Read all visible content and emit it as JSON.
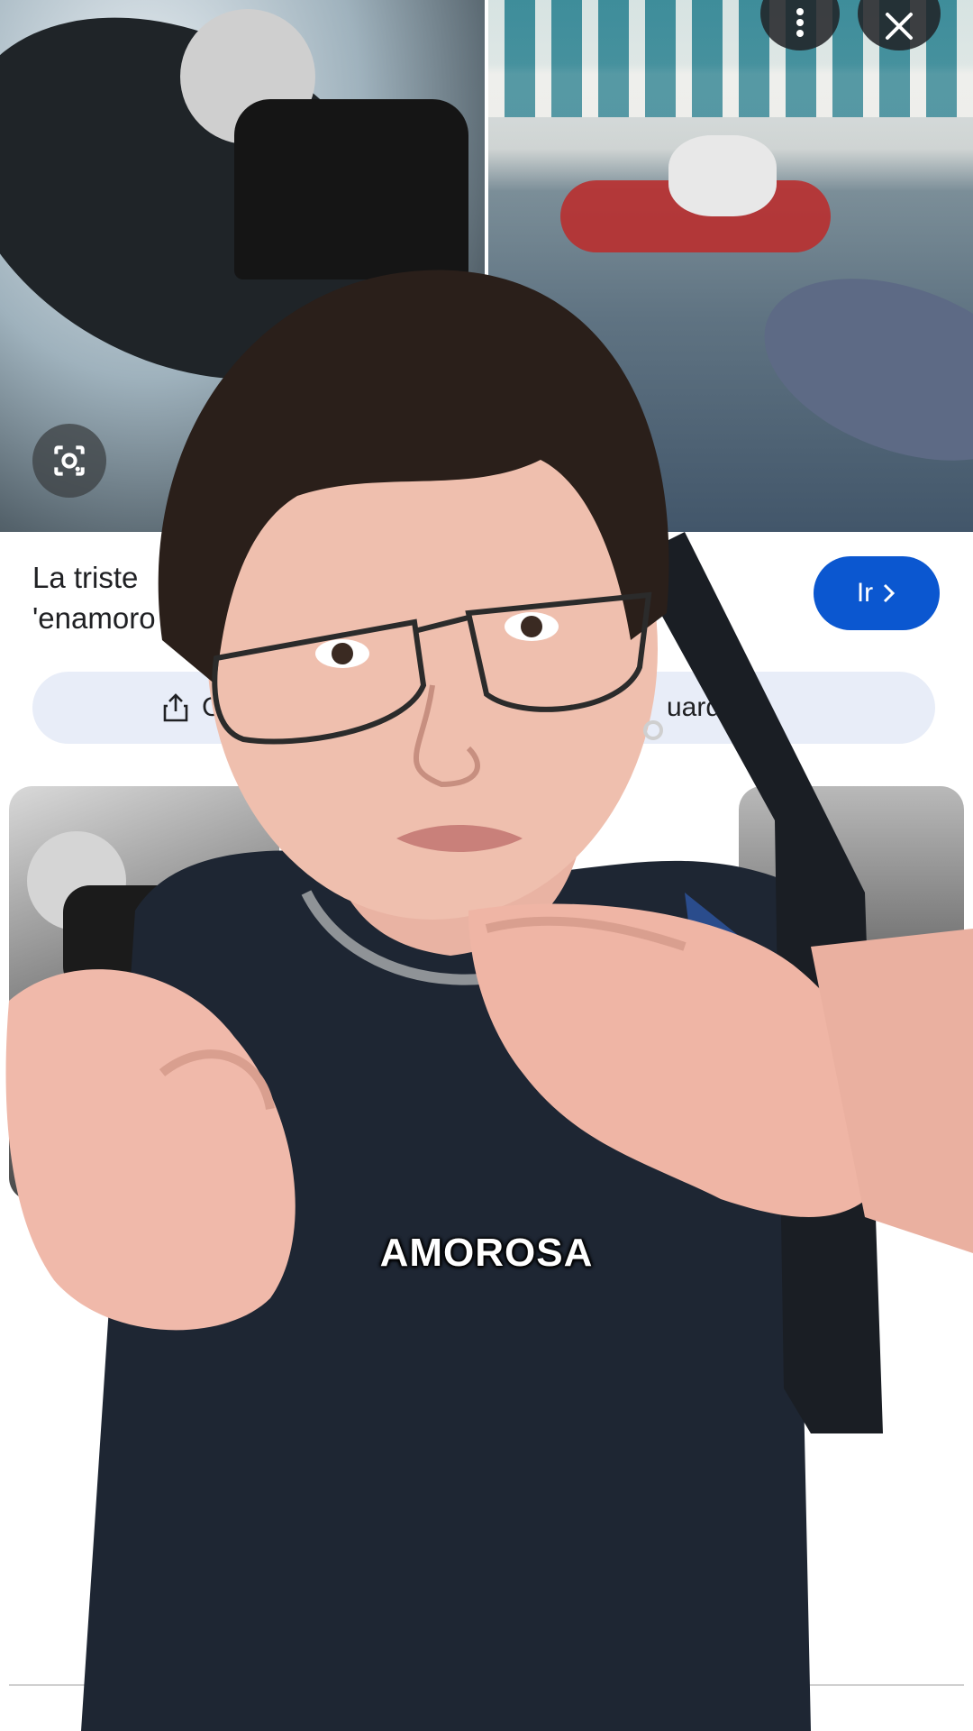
{
  "result": {
    "title_line1": "La triste",
    "title_line2": "'enamoro",
    "go_label": "Ir",
    "share_label": "C",
    "save_label": "uardar"
  },
  "overlay": {
    "caption": "AMOROSA"
  },
  "icons": {
    "lens": "google-lens-icon",
    "menu": "more-vert-icon",
    "close": "close-icon",
    "share": "share-icon",
    "chevron": "chevron-right-icon"
  },
  "colors": {
    "accent": "#0b57d0",
    "action_bar": "#e8edf8",
    "text": "#202124"
  }
}
